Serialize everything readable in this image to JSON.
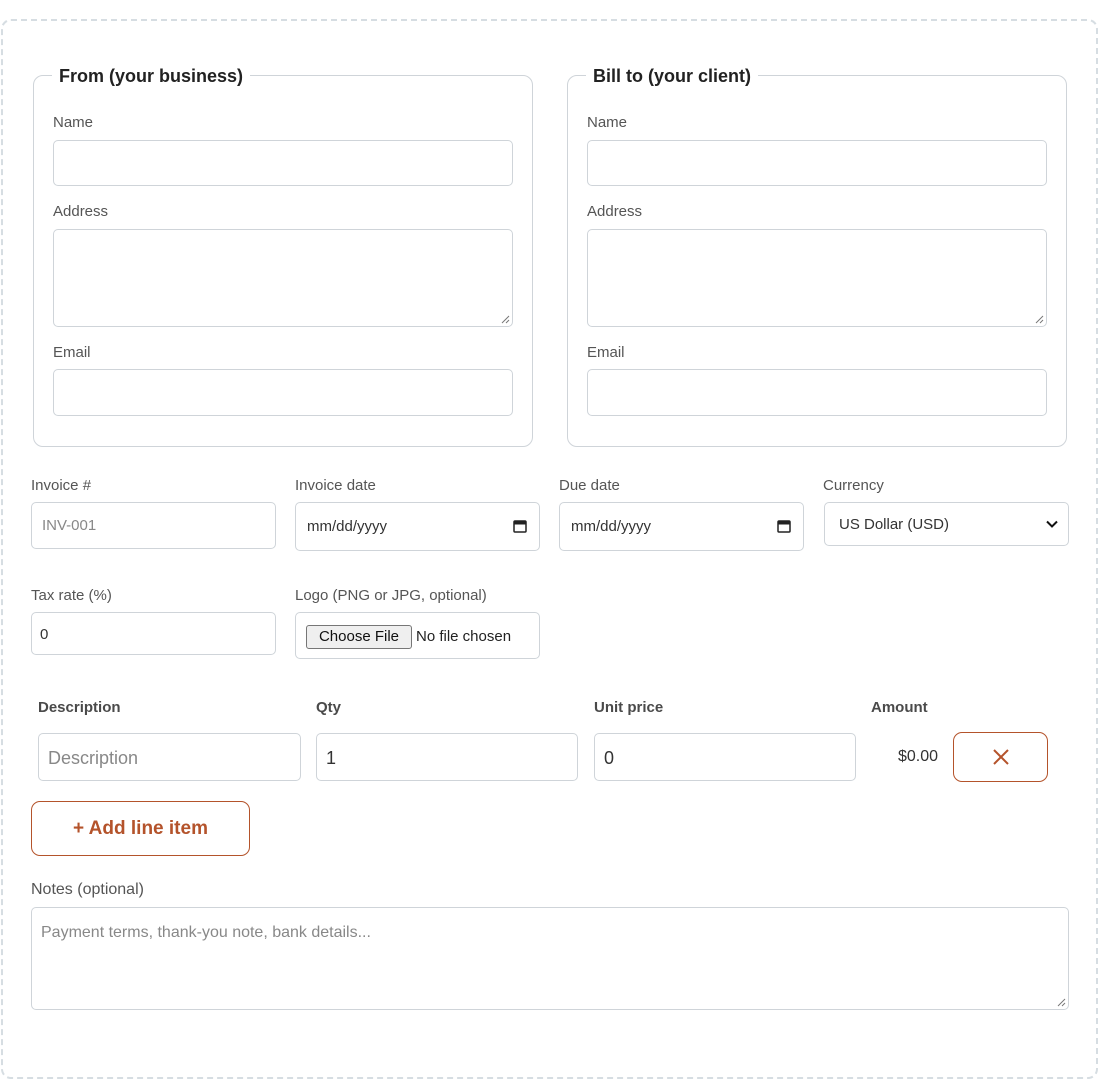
{
  "from": {
    "legend": "From (your business)",
    "name_label": "Name",
    "name_value": "",
    "address_label": "Address",
    "address_value": "",
    "email_label": "Email",
    "email_value": ""
  },
  "bill_to": {
    "legend": "Bill to (your client)",
    "name_label": "Name",
    "name_value": "",
    "address_label": "Address",
    "address_value": "",
    "email_label": "Email",
    "email_value": ""
  },
  "meta": {
    "invoice_number_label": "Invoice #",
    "invoice_number_placeholder": "INV-001",
    "invoice_date_label": "Invoice date",
    "invoice_date_value": "mm/dd/yyyy",
    "due_date_label": "Due date",
    "due_date_value": "mm/dd/yyyy",
    "currency_label": "Currency",
    "currency_value": "US Dollar (USD)",
    "tax_rate_label": "Tax rate (%)",
    "tax_rate_value": "0",
    "logo_label": "Logo (PNG or JPG, optional)",
    "logo_button": "Choose File",
    "logo_status": "No file chosen"
  },
  "line_items": {
    "headers": {
      "description": "Description",
      "qty": "Qty",
      "unit_price": "Unit price",
      "amount": "Amount"
    },
    "rows": [
      {
        "description_placeholder": "Description",
        "qty": "1",
        "unit_price": "0",
        "amount": "$0.00"
      }
    ],
    "add_label": "+ Add line item"
  },
  "notes": {
    "label": "Notes (optional)",
    "placeholder": "Payment terms, thank-you note, bank details..."
  },
  "colors": {
    "accent": "#b4532b",
    "border": "#cfd4d9",
    "dashed_frame": "#d6dde2"
  },
  "icons": {
    "calendar": "calendar-icon",
    "remove": "close-icon",
    "select": "chevron-down-icon"
  }
}
